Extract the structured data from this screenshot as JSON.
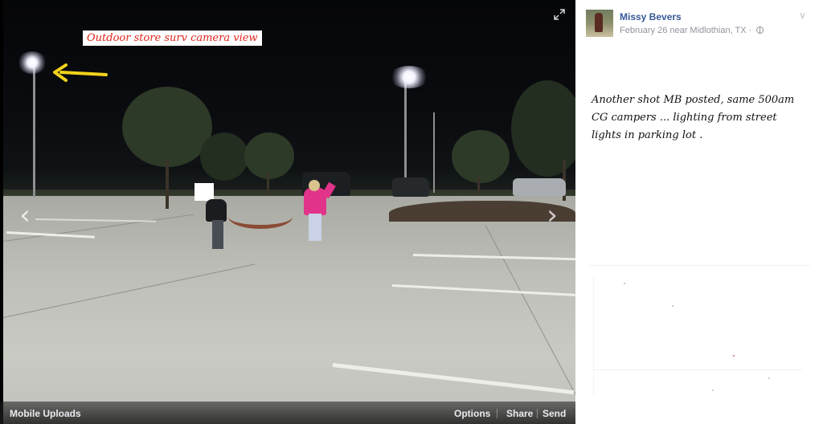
{
  "photo": {
    "overlay_caption": "Outdoor store surv camera view",
    "arrow_color": "#f2d21b",
    "caption_color": "#e0251b"
  },
  "bottom_bar": {
    "album": "Mobile Uploads",
    "actions": [
      "Options",
      "Share",
      "Send"
    ]
  },
  "post": {
    "author": "Missy Bevers",
    "meta": "February 26 near Midlothian, TX ·",
    "privacy_icon": "globe-icon",
    "menu_icon": "chevron-down-icon",
    "text": "Another shot MB posted, same 500am CG campers ...  lighting from street lights in parking lot ."
  },
  "colors": {
    "link": "#365899",
    "meta": "#90949c"
  }
}
